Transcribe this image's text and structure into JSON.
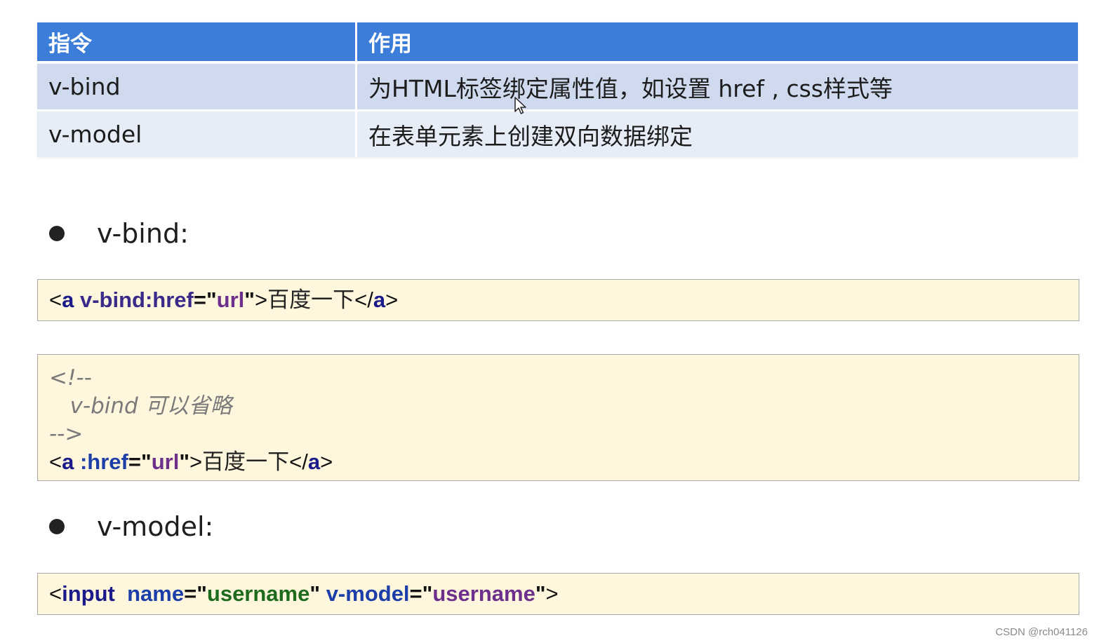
{
  "table": {
    "headers": [
      "指令",
      "作用"
    ],
    "rows": [
      {
        "directive": "v-bind",
        "purpose": "为HTML标签绑定属性值，如设置 href , css样式等"
      },
      {
        "directive": "v-model",
        "purpose": "在表单元素上创建双向数据绑定"
      }
    ]
  },
  "sections": {
    "vbind": {
      "label": "v-bind:",
      "code1": {
        "open_lt": "<",
        "tag": "a",
        "attr": "v-bind:href",
        "eq": "=",
        "quote": "\"",
        "value": "url",
        "gt": ">",
        "text": "百度一下",
        "close": "</",
        "close_tag": "a",
        "close_gt": ">"
      },
      "code2": {
        "comment_open": "<!--",
        "comment_body_code": "v-bind",
        "comment_body_text": "可以省略",
        "comment_close": "-->",
        "open_lt": "<",
        "tag": "a",
        "attr": ":href",
        "eq": "=",
        "quote": "\"",
        "value": "url",
        "gt": ">",
        "text": "百度一下",
        "close": "</",
        "close_tag": "a",
        "close_gt": ">"
      }
    },
    "vmodel": {
      "label": "v-model:",
      "code": {
        "open_lt": "<",
        "tag": "input",
        "attr1": "name",
        "eq": "=",
        "quote": "\"",
        "value1": "username",
        "attr2": "v-model",
        "value2": "username",
        "gt": ">"
      }
    }
  },
  "watermark": "CSDN @rch041126",
  "colors": {
    "header_bg": "#3b7dd8",
    "row1_bg": "#cfdaee",
    "row2_bg": "#e7edf7",
    "code_bg": "#fff7dd"
  },
  "icons": {
    "cursor": "mouse-pointer-icon",
    "bullet": "bullet-dot-icon"
  }
}
